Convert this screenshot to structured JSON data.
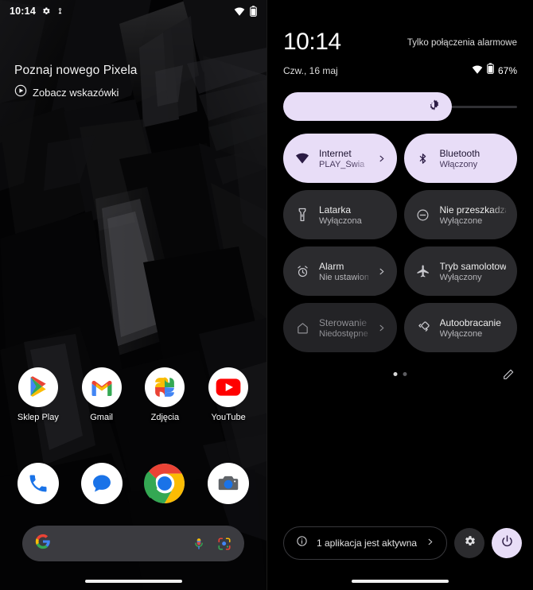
{
  "home": {
    "statusbar": {
      "time": "10:14",
      "icons": [
        "gear-icon",
        "notification-icon",
        "wifi-icon",
        "battery-icon"
      ]
    },
    "widget": {
      "title": "Poznaj nowego Pixela",
      "cta_label": "Zobacz wskazówki",
      "cta_icon": "play-circle-icon"
    },
    "apps": [
      {
        "label": "Sklep Play",
        "icon": "play-store-icon"
      },
      {
        "label": "Gmail",
        "icon": "gmail-icon"
      },
      {
        "label": "Zdjęcia",
        "icon": "google-photos-icon"
      },
      {
        "label": "YouTube",
        "icon": "youtube-icon"
      }
    ],
    "dock": [
      {
        "label": "Telefon",
        "icon": "phone-icon"
      },
      {
        "label": "Wiadomości",
        "icon": "messages-icon"
      },
      {
        "label": "Chrome",
        "icon": "chrome-icon"
      },
      {
        "label": "Aparat",
        "icon": "camera-icon"
      }
    ],
    "search": {
      "placeholder": "",
      "value": "",
      "logo": "google-g-icon",
      "mic": "microphone-icon",
      "lens": "google-lens-icon"
    }
  },
  "quicksettings": {
    "clock": "10:14",
    "carrier": "Tylko połączenia alarmowe",
    "date": "Czw., 16 maj",
    "battery_pct": "67%",
    "brightness": {
      "value": 72,
      "icon": "brightness-icon"
    },
    "tiles": [
      {
        "title": "Internet",
        "subtitle": "PLAY_Świa",
        "icon": "wifi-icon",
        "state": "on",
        "chevron": true
      },
      {
        "title": "Bluetooth",
        "subtitle": "Włączony",
        "icon": "bluetooth-icon",
        "state": "on",
        "chevron": false
      },
      {
        "title": "Latarka",
        "subtitle": "Wyłączona",
        "icon": "flashlight-icon",
        "state": "off",
        "chevron": false
      },
      {
        "title": "Nie przeszkadzać",
        "subtitle": "Wyłączone",
        "icon": "do-not-disturb-icon",
        "state": "off",
        "chevron": false
      },
      {
        "title": "Alarm",
        "subtitle": "Nie ustawiono",
        "icon": "alarm-icon",
        "state": "off",
        "chevron": true
      },
      {
        "title": "Tryb samolotowy",
        "subtitle": "Wyłączony",
        "icon": "airplane-icon",
        "state": "off",
        "chevron": false
      },
      {
        "title": "Sterowanie",
        "subtitle": "Niedostępne",
        "icon": "home-icon",
        "state": "dim",
        "chevron": true
      },
      {
        "title": "Autoobracanie",
        "subtitle": "Wyłączone",
        "icon": "auto-rotate-icon",
        "state": "off",
        "chevron": false
      }
    ],
    "pager": {
      "pages": 2,
      "active": 0
    },
    "edit_icon": "pencil-icon",
    "footer": {
      "active_apps_label": "1 aplikacja jest aktywna",
      "info_icon": "info-icon",
      "chevron_icon": "chevron-right-icon",
      "settings_icon": "gear-icon",
      "power_icon": "power-icon"
    }
  },
  "colors": {
    "accent": "#E8DDF7",
    "accent_text": "#1e1431",
    "tile_off": "#2B2B2E",
    "background": "#000000"
  }
}
